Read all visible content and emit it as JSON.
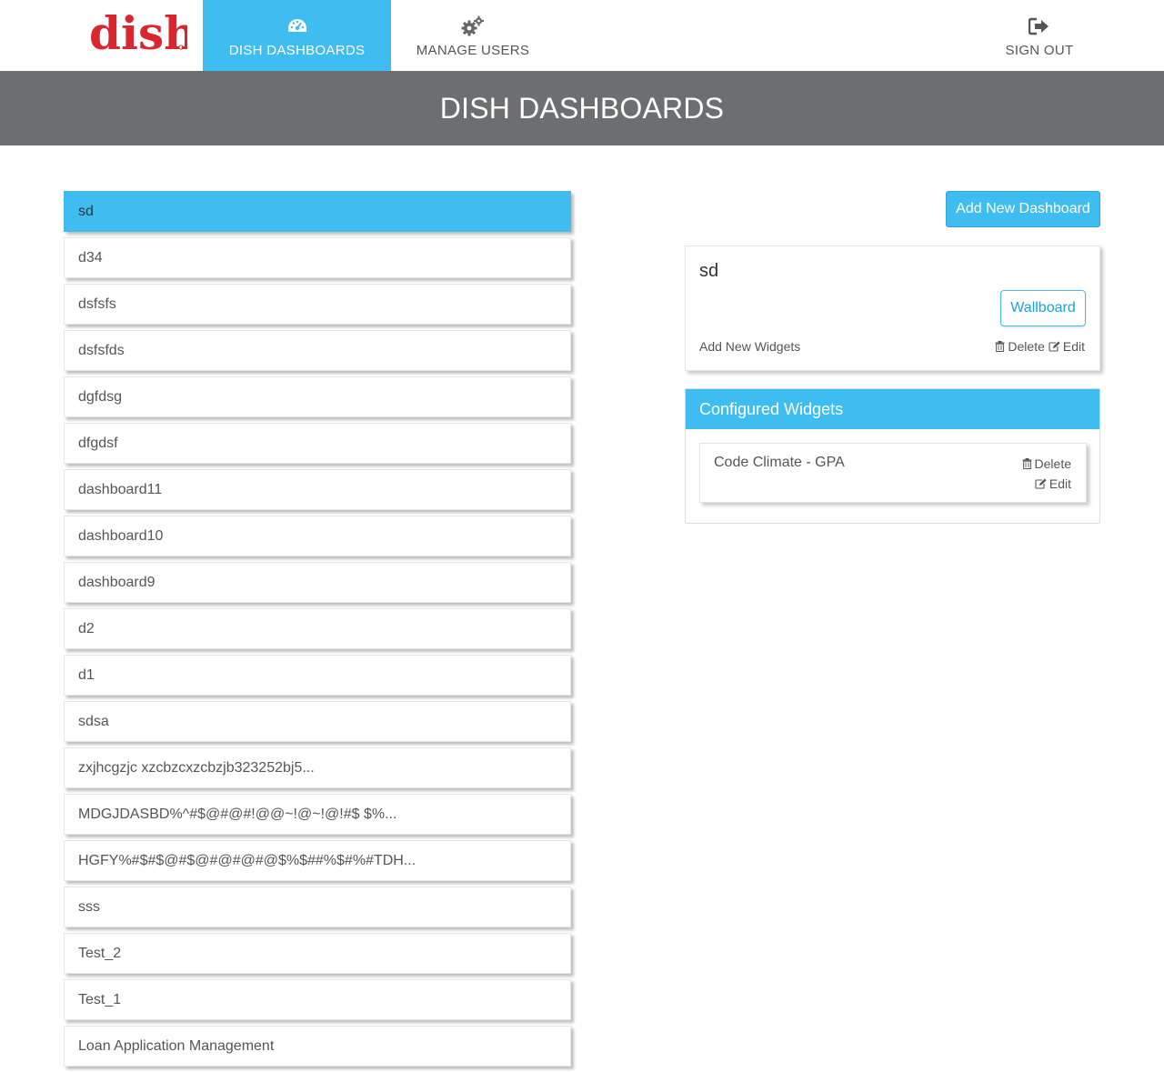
{
  "brand": {
    "logo_text": "dish",
    "color": "#d7282f"
  },
  "nav": {
    "dashboards_label": "DISH DASHBOARDS",
    "users_label": "MANAGE USERS",
    "signout_label": "SIGN OUT",
    "dashboards_icon": "dashboard-gauge-icon",
    "users_icon": "gears-icon",
    "signout_icon": "sign-out-icon"
  },
  "header": {
    "title": "DISH DASHBOARDS"
  },
  "dashboards": [
    {
      "label": "sd",
      "active": true
    },
    {
      "label": "d34"
    },
    {
      "label": "dsfsfs"
    },
    {
      "label": "dsfsfds"
    },
    {
      "label": "dgfdsg"
    },
    {
      "label": "dfgdsf"
    },
    {
      "label": "dashboard11"
    },
    {
      "label": "dashboard10"
    },
    {
      "label": "dashboard9"
    },
    {
      "label": "d2"
    },
    {
      "label": "d1"
    },
    {
      "label": "sdsa"
    },
    {
      "label": "zxjhcgzjc xzcbzcxzcbzjb323252bj5..."
    },
    {
      "label": "MDGJDASBD%^#$@#@#!@@~!@~!@!#$ $%..."
    },
    {
      "label": "HGFY%#$#$@#$@#@#@#@$%$##%$#%#TDH..."
    },
    {
      "label": "sss"
    },
    {
      "label": "Test_2"
    },
    {
      "label": "Test_1"
    },
    {
      "label": "Loan Application Management"
    }
  ],
  "actions": {
    "add_dashboard_label": "Add New Dashboard"
  },
  "detail": {
    "title": "sd",
    "wallboard_label": "Wallboard",
    "add_widgets_label": "Add New Widgets",
    "delete_label": "Delete",
    "edit_label": "Edit"
  },
  "widgets": {
    "header": "Configured Widgets",
    "items": [
      {
        "name": "Code Climate - GPA",
        "delete_label": "Delete",
        "edit_label": "Edit"
      }
    ]
  },
  "colors": {
    "accent": "#40bdf0",
    "header_bg": "#6d6e70",
    "brand_red": "#d7282f"
  }
}
